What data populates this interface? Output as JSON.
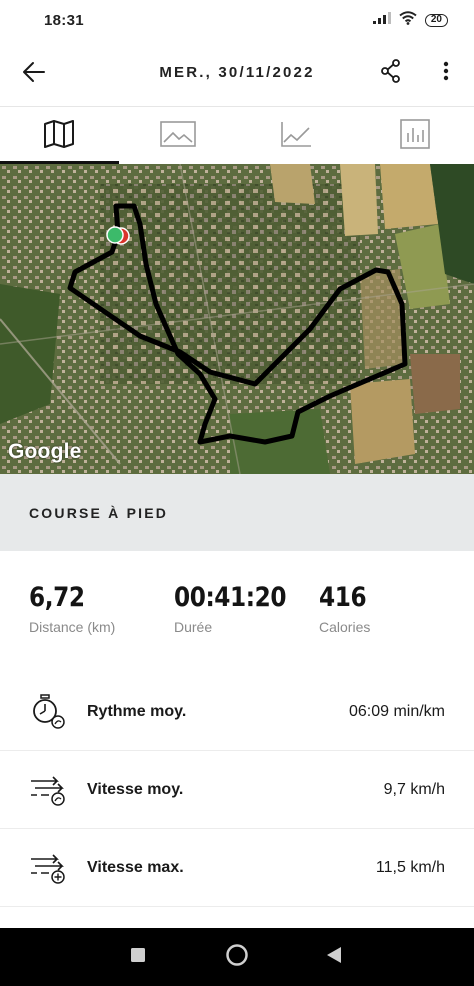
{
  "status_bar": {
    "time": "18:31",
    "battery": "20",
    "icons": [
      "signal-icon",
      "wifi-icon",
      "battery-icon"
    ]
  },
  "header": {
    "title": "MER., 30/11/2022",
    "back_icon": "arrow-left-icon",
    "share_icon": "share-icon",
    "more_icon": "more-vertical-icon"
  },
  "tabs": [
    {
      "name": "map",
      "icon": "map-icon",
      "active": true
    },
    {
      "name": "photos",
      "icon": "image-icon",
      "active": false
    },
    {
      "name": "graph",
      "icon": "line-chart-icon",
      "active": false
    },
    {
      "name": "stats",
      "icon": "bar-chart-icon",
      "active": false
    }
  ],
  "map": {
    "provider_logo": "Google",
    "track_color": "#000000",
    "start_marker_color": "#3cba6a",
    "end_marker_color": "#d9342b"
  },
  "activity": {
    "type": "COURSE À PIED"
  },
  "summary": {
    "distance": {
      "value": "6,72",
      "label": "Distance (km)"
    },
    "duration": {
      "value": "00:41:20",
      "label": "Durée"
    },
    "calories": {
      "value": "416",
      "label": "Calories"
    }
  },
  "metrics": [
    {
      "icon": "stopwatch-icon",
      "label": "Rythme moy.",
      "value": "06:09 min/km"
    },
    {
      "icon": "speed-avg-icon",
      "label": "Vitesse moy.",
      "value": "9,7 km/h"
    },
    {
      "icon": "speed-max-icon",
      "label": "Vitesse max.",
      "value": "11,5 km/h"
    }
  ],
  "nav_bar": {
    "buttons": [
      "recent-apps-icon",
      "home-icon",
      "back-triangle-icon"
    ]
  }
}
